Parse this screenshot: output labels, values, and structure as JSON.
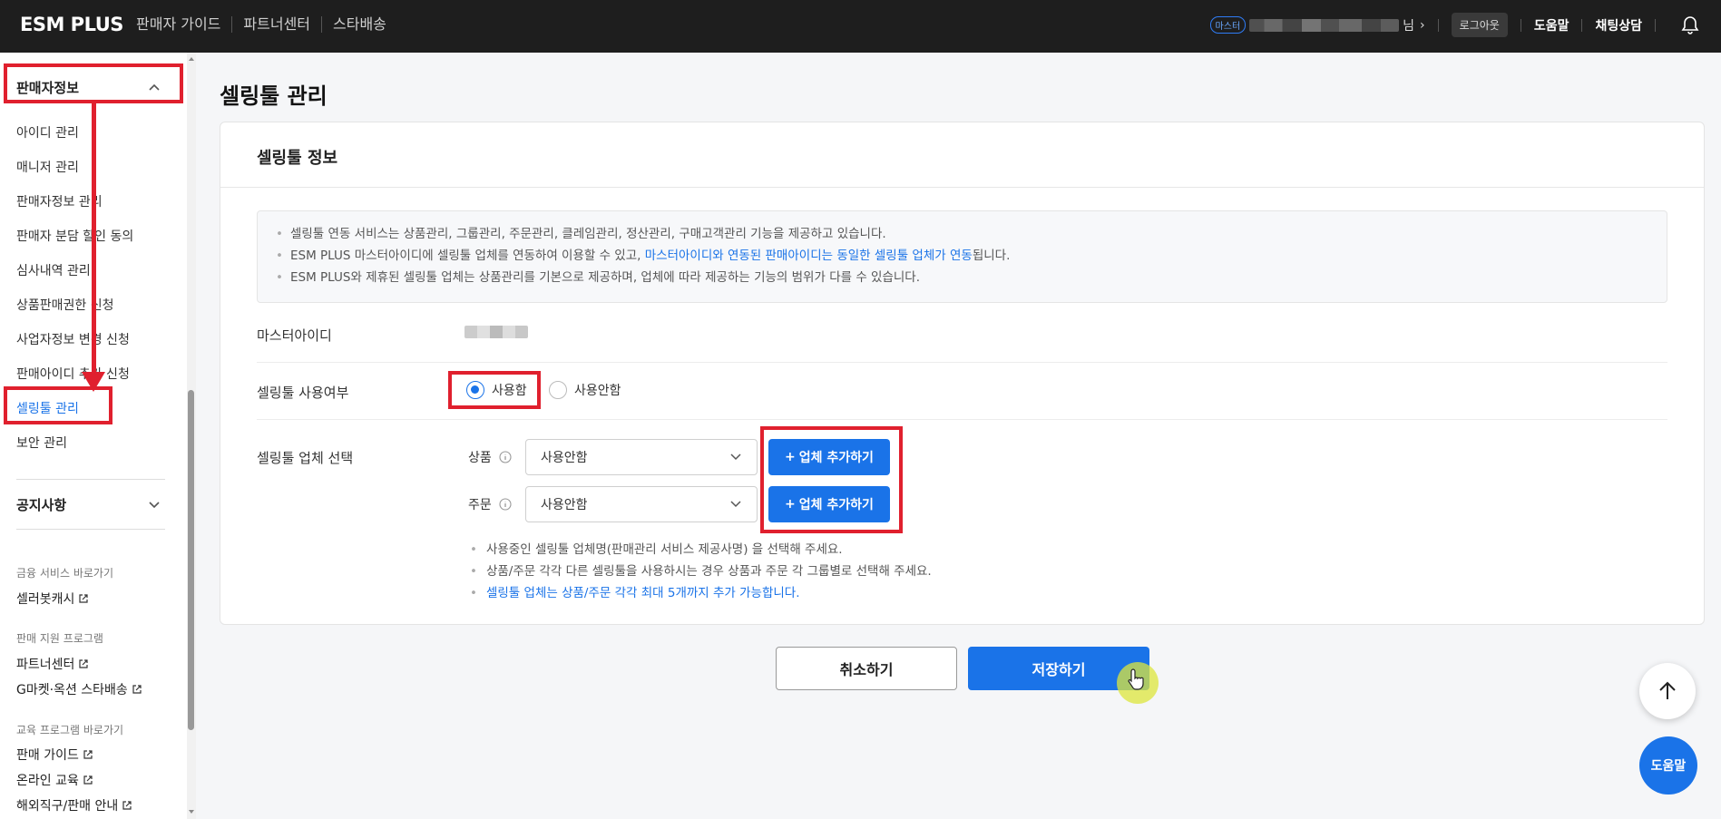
{
  "topbar": {
    "logo": "ESM PLUS",
    "nav": [
      "판매자 가이드",
      "파트너센터",
      "스타배송"
    ],
    "master_badge": "마스터",
    "user_suffix": "님",
    "logout": "로그아웃",
    "help": "도움말",
    "chat": "채팅상담"
  },
  "sidebar": {
    "section_seller": "판매자정보",
    "items": [
      {
        "label": "아이디 관리"
      },
      {
        "label": "매니저 관리"
      },
      {
        "label": "판매자정보 관리"
      },
      {
        "label": "판매자 분담 할인 동의"
      },
      {
        "label": "심사내역 관리"
      },
      {
        "label": "상품판매권한 신청"
      },
      {
        "label": "사업자정보 변경 신청"
      },
      {
        "label": "판매아이디 추가 신청"
      },
      {
        "label": "셀링툴 관리",
        "active": true
      },
      {
        "label": "보안 관리"
      }
    ],
    "section_notice": "공지사항",
    "group1_title": "금융 서비스 바로가기",
    "group1_links": [
      "셀러봇캐시"
    ],
    "group2_title": "판매 지원 프로그램",
    "group2_links": [
      "파트너센터",
      "G마켓·옥션 스타배송"
    ],
    "group3_title": "교육 프로그램 바로가기",
    "group3_links": [
      "판매 가이드",
      "온라인 교육",
      "해외직구/판매 안내"
    ]
  },
  "page": {
    "title": "셀링툴 관리",
    "card_title": "셀링툴 정보",
    "notice": {
      "line1": "셀링툴 연동 서비스는 상품관리, 그룹관리, 주문관리, 클레임관리, 정산관리, 구매고객관리 기능을 제공하고 있습니다.",
      "line2_pre": "ESM PLUS 마스터아이디에 셀링툴 업체를 연동하여 이용할 수 있고, ",
      "line2_hl": "마스터아이디와 연동된 판매아이디는 동일한 셀링툴 업체가 연동",
      "line2_post": "됩니다.",
      "line3": "ESM PLUS와 제휴된 셀링툴 업체는 상품관리를 기본으로 제공하며, 업체에 따라 제공하는 기능의 범위가 다를 수 있습니다."
    },
    "master_id_label": "마스터아이디",
    "usage_label": "셀링툴 사용여부",
    "usage_on": "사용함",
    "usage_off": "사용안함",
    "vendor_label": "셀링툴 업체 선택",
    "product_label": "상품",
    "order_label": "주문",
    "product_select": "사용안함",
    "order_select": "사용안함",
    "add_vendor": "업체 추가하기",
    "help1": "사용중인 셀링툴 업체명(판매관리 서비스 제공사명) 을 선택해 주세요.",
    "help2": "상품/주문 각각 다른 셀링툴을 사용하시는 경우 상품과 주문 각 그룹별로 선택해 주세요.",
    "help3": "셀링툴 업체는 상품/주문 각각 최대 5개까지 추가 가능합니다.",
    "cancel": "취소하기",
    "save": "저장하기",
    "fab_help": "도움말"
  },
  "colors": {
    "accent": "#1a73e8",
    "annotation": "#e0202e",
    "topbar": "#1e1e1e"
  }
}
